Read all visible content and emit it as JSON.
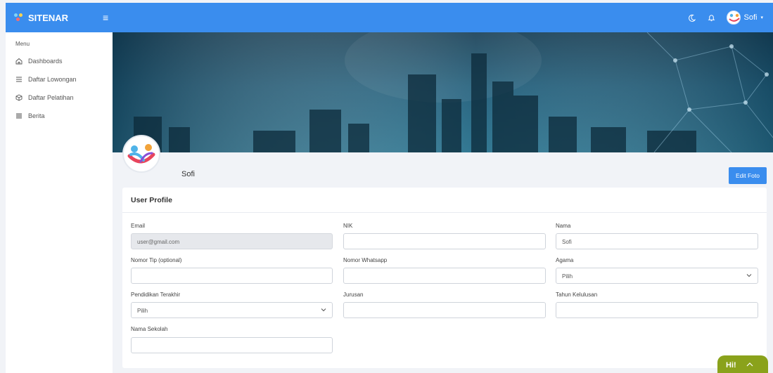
{
  "app": {
    "brand": "SITENAR"
  },
  "topbar": {
    "user_name": "Sofi"
  },
  "sidebar": {
    "menu_header": "Menu",
    "items": [
      {
        "label": "Dashboards",
        "icon": "home-icon"
      },
      {
        "label": "Daftar Lowongan",
        "icon": "list-icon"
      },
      {
        "label": "Daftar Pelatihan",
        "icon": "cube-icon"
      },
      {
        "label": "Berita",
        "icon": "news-icon"
      }
    ]
  },
  "profile": {
    "name": "Sofi",
    "edit_photo_label": "Edit Foto"
  },
  "form": {
    "title": "User Profile",
    "email_label": "Email",
    "email_value": "user@gmail.com",
    "nik_label": "NIK",
    "nik_value": "",
    "nama_label": "Nama",
    "nama_value": "Sofi",
    "nomor_tip_label": "Nomor Tip (optional)",
    "nomor_tip_value": "",
    "whatsapp_label": "Nomor Whatsapp",
    "whatsapp_value": "",
    "agama_label": "Agama",
    "agama_value": "Pilih",
    "pendidikan_label": "Pendidikan Terakhir",
    "pendidikan_value": "Pilih",
    "jurusan_label": "Jurusan",
    "jurusan_value": "",
    "tahun_label": "Tahun Kelulusan",
    "tahun_value": "",
    "sekolah_label": "Nama Sekolah",
    "sekolah_value": ""
  },
  "chat": {
    "label": "Hi!"
  },
  "colors": {
    "primary": "#3a8dee",
    "chat": "#8aa21b",
    "banner": "#1d5b78"
  }
}
